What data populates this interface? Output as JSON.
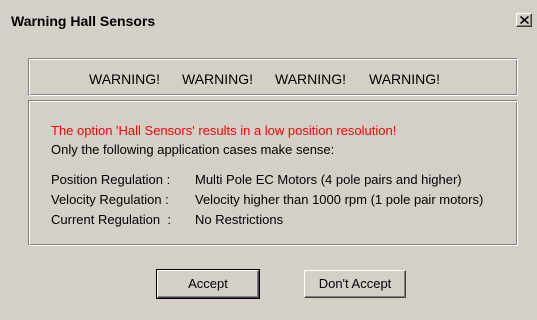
{
  "window": {
    "title": "Warning Hall Sensors"
  },
  "warnings": [
    "WARNING!",
    "WARNING!",
    "WARNING!",
    "WARNING!"
  ],
  "message": {
    "alert": "The option 'Hall Sensors' results in a low position resolution!",
    "intro": "Only the following application cases make sense:"
  },
  "cases": [
    {
      "label": "Position Regulation :",
      "value": "Multi Pole EC Motors (4 pole pairs and higher)"
    },
    {
      "label": "Velocity Regulation :",
      "value": "Velocity higher than 1000 rpm (1 pole pair motors)"
    },
    {
      "label": "Current Regulation  :",
      "value": "No Restrictions"
    }
  ],
  "buttons": {
    "accept": "Accept",
    "dont_accept": "Don't Accept"
  },
  "colors": {
    "dialog_background": "#d4d0c8",
    "alert_text": "#ff0000"
  }
}
